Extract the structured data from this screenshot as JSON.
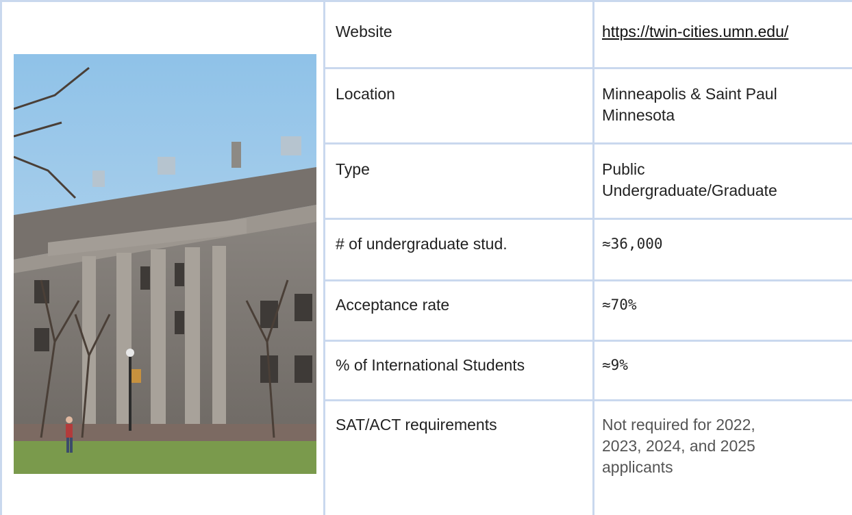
{
  "rows": [
    {
      "label": "Website",
      "value": "https://twin-cities.umn.edu/"
    },
    {
      "label": "Location",
      "value_lines": [
        "Minneapolis & Saint Paul",
        "Minnesota"
      ]
    },
    {
      "label": "Type",
      "value_lines": [
        "Public",
        "Undergraduate/Graduate"
      ]
    },
    {
      "label": "# of undergraduate stud.",
      "value": "≈36,000"
    },
    {
      "label": "Acceptance rate",
      "value": "≈70%"
    },
    {
      "label": "% of International Students",
      "value": "≈9%"
    },
    {
      "label": "SAT/ACT requirements",
      "value_lines": [
        "Not required for 2022,",
        "2023, 2024, and 2025",
        "applicants"
      ]
    }
  ],
  "colors": {
    "border": "#c9d8ee",
    "text": "#222222",
    "muted_text": "#555555"
  },
  "photo": {
    "icon": "campus-building-photo"
  }
}
